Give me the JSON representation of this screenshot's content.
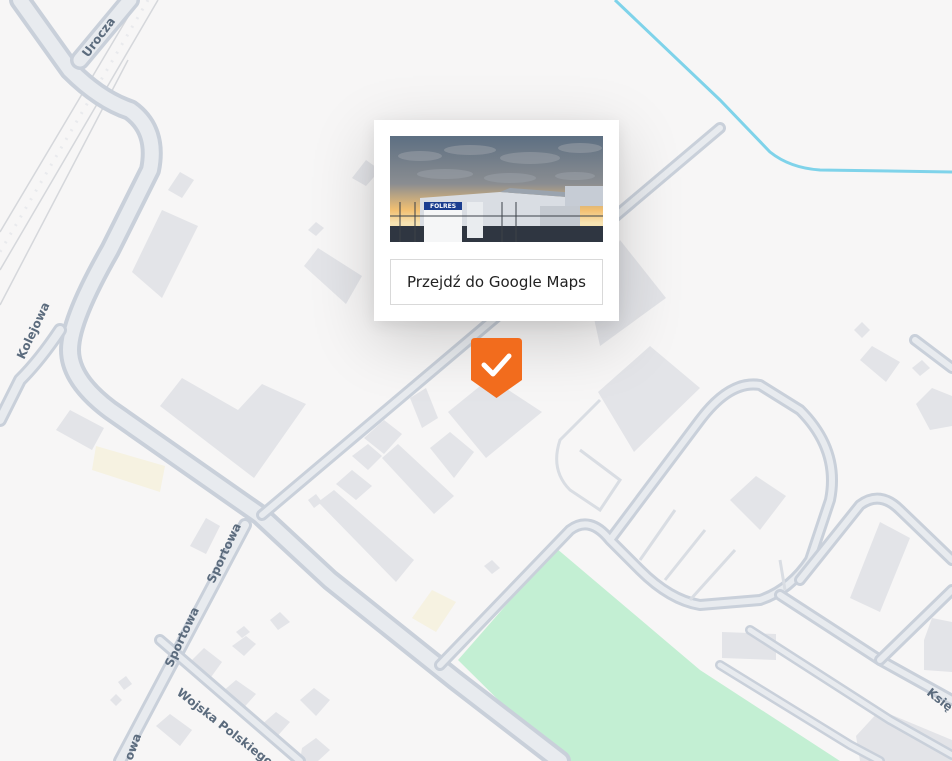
{
  "map": {
    "streets": {
      "urocza": "Urocza",
      "kolejowa": "Kolejowa",
      "sportowa_1": "Sportowa",
      "sportowa_2": "Sportowa",
      "wojska_polskiego": "Wojska Polskiego",
      "ksiezycowa_partial": "Księ",
      "partial_left": "owa"
    },
    "colors": {
      "background": "#f7f6f6",
      "road": "#c9d0da",
      "road_inner": "#e6e9ee",
      "building": "#e3e4e8",
      "park": "#c3efd3",
      "water": "#7fd3ea",
      "marker": "#f26c1d"
    }
  },
  "popup": {
    "photo": {
      "sign_text": "FOLRES",
      "icon": "warehouse-photo"
    },
    "button_label": "Przejdź do Google Maps"
  },
  "marker": {
    "icon": "checkmark-icon"
  }
}
